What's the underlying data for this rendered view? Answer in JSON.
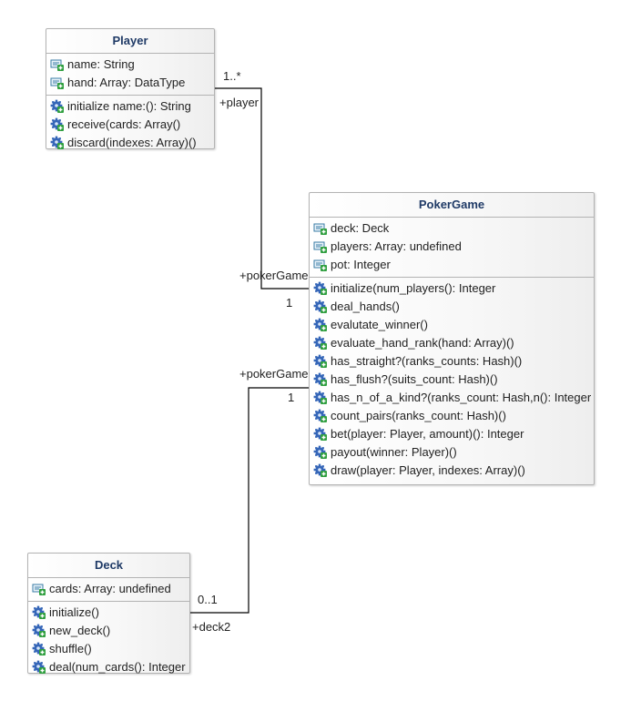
{
  "classes": {
    "player": {
      "name": "Player",
      "attributes": [
        "name: String",
        "hand: Array: DataType"
      ],
      "operations": [
        "initialize name:(): String",
        "receive(cards: Array()",
        "discard(indexes: Array)()"
      ]
    },
    "pokergame": {
      "name": "PokerGame",
      "attributes": [
        "deck: Deck",
        "players: Array: undefined",
        "pot: Integer"
      ],
      "operations": [
        "initialize(num_players(): Integer",
        "deal_hands()",
        "evalutate_winner()",
        "evaluate_hand_rank(hand: Array)()",
        "has_straight?(ranks_counts: Hash)()",
        "has_flush?(suits_count: Hash)()",
        "has_n_of_a_kind?(ranks_count: Hash,n(): Integer",
        "count_pairs(ranks_count: Hash)()",
        "bet(player: Player, amount)(): Integer",
        "payout(winner: Player)()",
        "draw(player: Player, indexes: Array)()"
      ]
    },
    "deck": {
      "name": "Deck",
      "attributes": [
        "cards: Array: undefined"
      ],
      "operations": [
        "initialize()",
        "new_deck()",
        "shuffle()",
        "deal(num_cards(): Integer"
      ]
    }
  },
  "associations": {
    "player_game": {
      "player_multiplicity": "1..*",
      "player_role": "+player",
      "game_role": "+pokerGame",
      "game_multiplicity": "1"
    },
    "deck_game": {
      "game_role": "+pokerGame",
      "game_multiplicity": "1",
      "deck_multiplicity": "0..1",
      "deck_role": "+deck2"
    }
  },
  "colors": {
    "title": "#1f3a66",
    "border": "#b3b3b3",
    "attribute_icon": "#3a7ca5",
    "operation_icon": "#3566b8",
    "plus": "#2e9e3e"
  },
  "icons": {
    "attribute": "attribute-icon",
    "operation": "operation-icon"
  }
}
